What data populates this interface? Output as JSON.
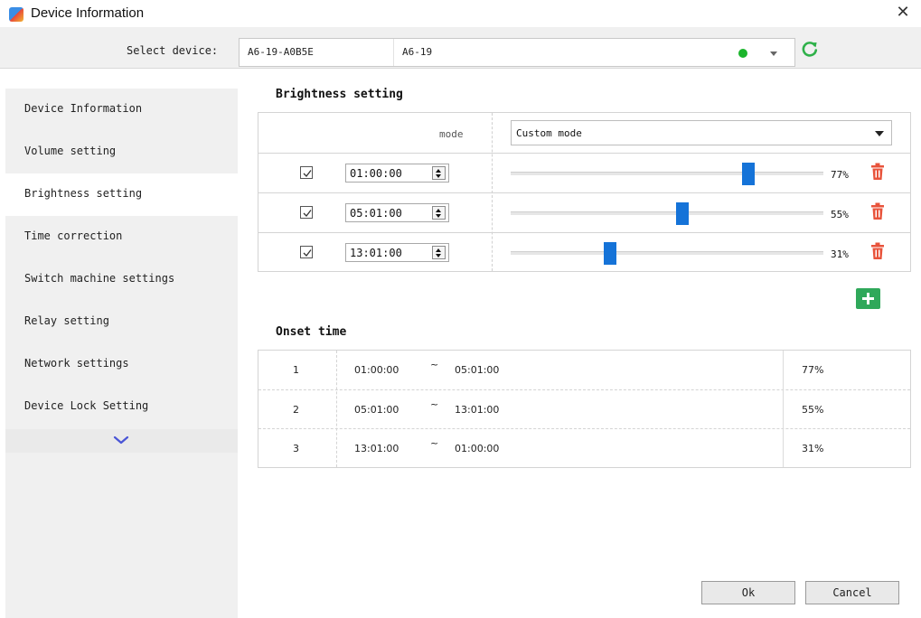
{
  "window": {
    "title": "Device Information",
    "close_icon": "close-icon"
  },
  "device": {
    "label": "Select device:",
    "id": "A6-19-A0B5E",
    "name": "A6-19",
    "status_color": "#1bb52c"
  },
  "sidebar": {
    "items": [
      {
        "label": "Device Information"
      },
      {
        "label": "Volume setting"
      },
      {
        "label": "Brightness setting"
      },
      {
        "label": "Time correction"
      },
      {
        "label": "Switch machine settings"
      },
      {
        "label": "Relay setting"
      },
      {
        "label": "Network settings"
      },
      {
        "label": "Device Lock Setting"
      }
    ],
    "active_index": 2
  },
  "brightness": {
    "title": "Brightness setting",
    "mode_label": "mode",
    "mode_value": "Custom mode",
    "rows": [
      {
        "checked": true,
        "time": "01:00:00",
        "level": 77,
        "percent": "77%"
      },
      {
        "checked": true,
        "time": "05:01:00",
        "level": 55,
        "percent": "55%"
      },
      {
        "checked": true,
        "time": "13:01:00",
        "level": 31,
        "percent": "31%"
      }
    ],
    "accent_color": "#1573d8",
    "delete_color": "#e8533b",
    "add_color": "#2fa85a"
  },
  "onset": {
    "title": "Onset time",
    "rows": [
      {
        "index": "1",
        "start": "01:00:00",
        "sep": "~",
        "end": "05:01:00",
        "percent": "77%"
      },
      {
        "index": "2",
        "start": "05:01:00",
        "sep": "~",
        "end": "13:01:00",
        "percent": "55%"
      },
      {
        "index": "3",
        "start": "13:01:00",
        "sep": "~",
        "end": "01:00:00",
        "percent": "31%"
      }
    ]
  },
  "footer": {
    "ok_label": "Ok",
    "cancel_label": "Cancel"
  }
}
